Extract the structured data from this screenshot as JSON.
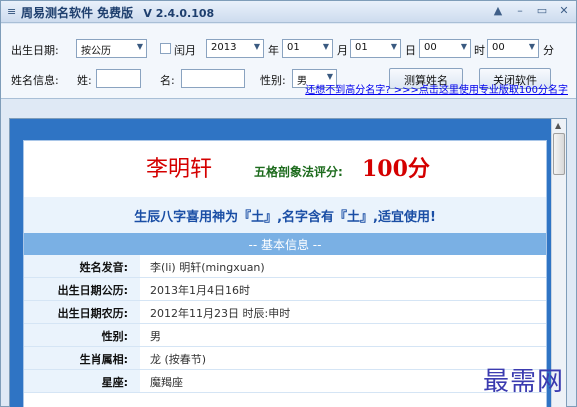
{
  "window": {
    "title": "周易测名软件 免费版",
    "version": "V 2.4.0.108",
    "controls": [
      "▲",
      "–",
      "▭",
      "✕"
    ]
  },
  "toolbar": {
    "birth_label": "出生日期:",
    "calendar_select": "按公历",
    "leap_label": "闰月",
    "year": "2013",
    "year_unit": "年",
    "month": "01",
    "month_unit": "月",
    "day": "01",
    "day_unit": "日",
    "hour": "00",
    "hour_unit": "时",
    "minute": "00",
    "minute_unit": "分",
    "nameinfo_label": "姓名信息:",
    "surname_label": "姓:",
    "surname_value": "",
    "given_label": "名:",
    "given_value": "",
    "gender_label": "性别:",
    "gender_select": "男",
    "calc_button": "测算姓名",
    "close_button": "关闭软件",
    "promo_link": "还想不到高分名字? >>>点击这里使用专业版取100分名字"
  },
  "result": {
    "name": "李明轩",
    "score_label": "五格剖象法评分:",
    "score_value": "100分",
    "verdict": "生辰八字喜用神为『土』,名字含有『土』,适宜使用!",
    "section_title": "-- 基本信息 --",
    "rows": [
      {
        "key": "姓名发音:",
        "value": "李(li) 明轩(mingxuan)"
      },
      {
        "key": "出生日期公历:",
        "value": "2013年1月4日16时"
      },
      {
        "key": "出生日期农历:",
        "value": "2012年11月23日 时辰:申时"
      },
      {
        "key": "性别:",
        "value": "男"
      },
      {
        "key": "生肖属相:",
        "value": "龙 (按春节)"
      },
      {
        "key": "星座:",
        "value": "魔羯座"
      }
    ]
  },
  "watermark": "最需网",
  "colors": {
    "accent": "#2f74c4",
    "name_red": "#d40000",
    "verdict_blue": "#1a4ea5",
    "section_bg": "#7ab0e4"
  }
}
